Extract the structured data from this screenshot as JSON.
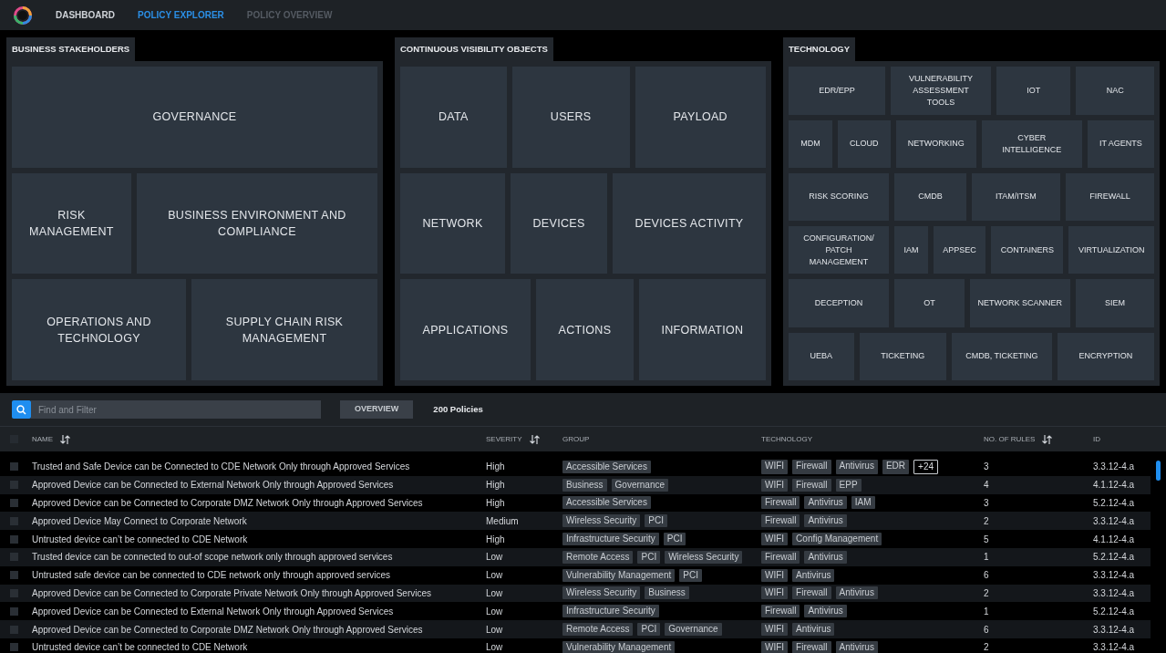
{
  "nav": {
    "items": [
      {
        "label": "DASHBOARD",
        "selected": false,
        "disabled": false
      },
      {
        "label": "POLICY EXPLORER",
        "selected": true,
        "disabled": false
      },
      {
        "label": "POLICY OVERVIEW",
        "selected": false,
        "disabled": true
      }
    ]
  },
  "panels": [
    {
      "title": "BUSINESS STAKEHOLDERS",
      "rows": [
        [
          "GOVERNANCE"
        ],
        [
          "RISK MANAGEMENT",
          "BUSINESS ENVIRONMENT AND COMPLIANCE"
        ],
        [
          "OPERATIONS AND TECHNOLOGY",
          "SUPPLY CHAIN RISK MANAGEMENT"
        ]
      ]
    },
    {
      "title": "CONTINUOUS VISIBILITY OBJECTS",
      "rows": [
        [
          "DATA",
          "USERS",
          "PAYLOAD"
        ],
        [
          "NETWORK",
          "DEVICES",
          "DEVICES ACTIVITY"
        ],
        [
          "APPLICATIONS",
          "ACTIONS",
          "INFORMATION"
        ]
      ]
    },
    {
      "title": "TECHNOLOGY",
      "rows": [
        [
          "EDR/EPP",
          "VULNERABILITY ASSESSMENT TOOLS",
          "IOT",
          "NAC"
        ],
        [
          "MDM",
          "CLOUD",
          "NETWORKING",
          "CYBER INTELLIGENCE",
          "IT AGENTS"
        ],
        [
          "RISK SCORING",
          "CMDB",
          "ITAM/ITSM",
          "FIREWALL"
        ],
        [
          "CONFIGURATION/ PATCH MANAGEMENT",
          "IAM",
          "APPSEC",
          "CONTAINERS",
          "VIRTUALIZATION"
        ],
        [
          "DECEPTION",
          "OT",
          "NETWORK SCANNER",
          "SIEM"
        ],
        [
          "UEBA",
          "TICKETING",
          "CMDB, TICKETING",
          "ENCRYPTION"
        ]
      ]
    }
  ],
  "toolbar": {
    "search": {
      "placeholder": "Find and Filter"
    },
    "overview_button": "OVERVIEW",
    "count": "200 Policies"
  },
  "table": {
    "all_checked": false,
    "columns": [
      {
        "label": "NAME",
        "sortable": true
      },
      {
        "label": "SEVERITY",
        "sortable": true
      },
      {
        "label": "GROUP",
        "sortable": false
      },
      {
        "label": "TECHNOLOGY",
        "sortable": false
      },
      {
        "label": "NO. OF RULES",
        "sortable": true
      },
      {
        "label": "ID",
        "sortable": false
      }
    ],
    "rows": [
      {
        "checked": false,
        "name": "Trusted and Safe Device can be Connected to CDE Network Only through Approved Services",
        "severity": "High",
        "group": [
          "Accessible Services"
        ],
        "technology": [
          "WIFI",
          "Firewall",
          "Antivirus",
          "EDR"
        ],
        "more": "+24",
        "rules": "3",
        "id": "3.3.12-4.a"
      },
      {
        "checked": false,
        "name": "Approved Device can be Connected to External Network Only through Approved Services",
        "severity": "High",
        "group": [
          "Business",
          "Governance"
        ],
        "technology": [
          "WIFI",
          "Firewall",
          "EPP"
        ],
        "rules": "4",
        "id": "4.1.12-4.a"
      },
      {
        "checked": false,
        "name": "Approved Device can be Connected to Corporate DMZ Network Only through Approved Services",
        "severity": "High",
        "group": [
          "Accessible Services"
        ],
        "technology": [
          "Firewall",
          "Antivirus",
          "IAM"
        ],
        "rules": "3",
        "id": "5.2.12-4.a"
      },
      {
        "checked": false,
        "name": "Approved Device May Connect to Corporate Network",
        "severity": "Medium",
        "group": [
          "Wireless Security",
          "PCI"
        ],
        "technology": [
          "Firewall",
          "Antivirus"
        ],
        "rules": "2",
        "id": "3.3.12-4.a"
      },
      {
        "checked": false,
        "name": "Untrusted device can’t be connected to CDE Network",
        "severity": "High",
        "group": [
          "Infrastructure Security",
          "PCI"
        ],
        "technology": [
          "WIFI",
          "Config Management"
        ],
        "rules": "5",
        "id": "4.1.12-4.a"
      },
      {
        "checked": false,
        "name": "Trusted device can be connected to out-of scope network only through approved services",
        "severity": "Low",
        "group": [
          "Remote Access",
          "PCI",
          "Wireless Security"
        ],
        "technology": [
          "Firewall",
          "Antivirus"
        ],
        "rules": "1",
        "id": "5.2.12-4.a"
      },
      {
        "checked": false,
        "name": "Untrusted safe device can be connected to CDE network only through approved services",
        "severity": "Low",
        "group": [
          "Vulnerability Management",
          "PCI"
        ],
        "technology": [
          "WIFI",
          "Antivirus"
        ],
        "rules": "6",
        "id": "3.3.12-4.a"
      },
      {
        "checked": false,
        "name": "Approved Device can be Connected to Corporate Private Network Only through Approved Services",
        "severity": "Low",
        "group": [
          "Wireless Security",
          "Business"
        ],
        "technology": [
          "WIFI",
          "Firewall",
          "Antivirus"
        ],
        "rules": "2",
        "id": "3.3.12-4.a"
      },
      {
        "checked": false,
        "name": "Approved Device can be Connected to External Network Only through Approved Services",
        "severity": "Low",
        "group": [
          "Infrastructure Security"
        ],
        "technology": [
          "Firewall",
          "Antivirus"
        ],
        "rules": "1",
        "id": "5.2.12-4.a"
      },
      {
        "checked": false,
        "name": "Approved Device can be Connected to Corporate DMZ Network Only through Approved Services",
        "severity": "Low",
        "group": [
          "Remote Access",
          "PCI",
          "Governance"
        ],
        "technology": [
          "WIFI",
          "Antivirus"
        ],
        "rules": "6",
        "id": "3.3.12-4.a"
      },
      {
        "checked": false,
        "name": "Untrusted device can’t be connected to CDE Network",
        "severity": "Low",
        "group": [
          "Vulnerability Management"
        ],
        "technology": [
          "WIFI",
          "Firewall",
          "Antivirus"
        ],
        "rules": "2",
        "id": "3.3.12-4.a"
      }
    ]
  }
}
